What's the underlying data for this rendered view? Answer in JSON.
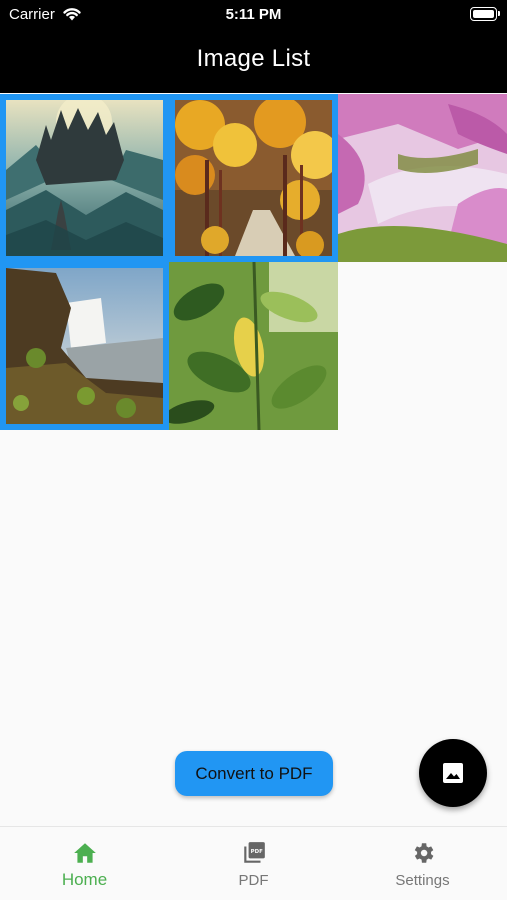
{
  "status_bar": {
    "carrier": "Carrier",
    "time": "5:11 PM"
  },
  "app_bar": {
    "title": "Image List"
  },
  "grid": {
    "images": [
      {
        "subject": "castle in misty mountains",
        "selected": true
      },
      {
        "subject": "autumn forest path",
        "selected": true
      },
      {
        "subject": "pink blossom trees by river",
        "selected": false
      },
      {
        "subject": "waterfall with mossy cliff",
        "selected": true
      },
      {
        "subject": "green leaves close-up",
        "selected": false
      }
    ]
  },
  "actions": {
    "convert_label": "Convert to PDF",
    "fab_icon": "image-icon"
  },
  "bottom_nav": {
    "items": [
      {
        "label": "Home",
        "icon": "home-icon",
        "active": true
      },
      {
        "label": "PDF",
        "icon": "pdf-icon",
        "active": false
      },
      {
        "label": "Settings",
        "icon": "gear-icon",
        "active": false
      }
    ]
  },
  "colors": {
    "accent": "#2196f3",
    "active_nav": "#4caf50",
    "inactive_nav": "#777777",
    "app_bar": "#000000"
  }
}
